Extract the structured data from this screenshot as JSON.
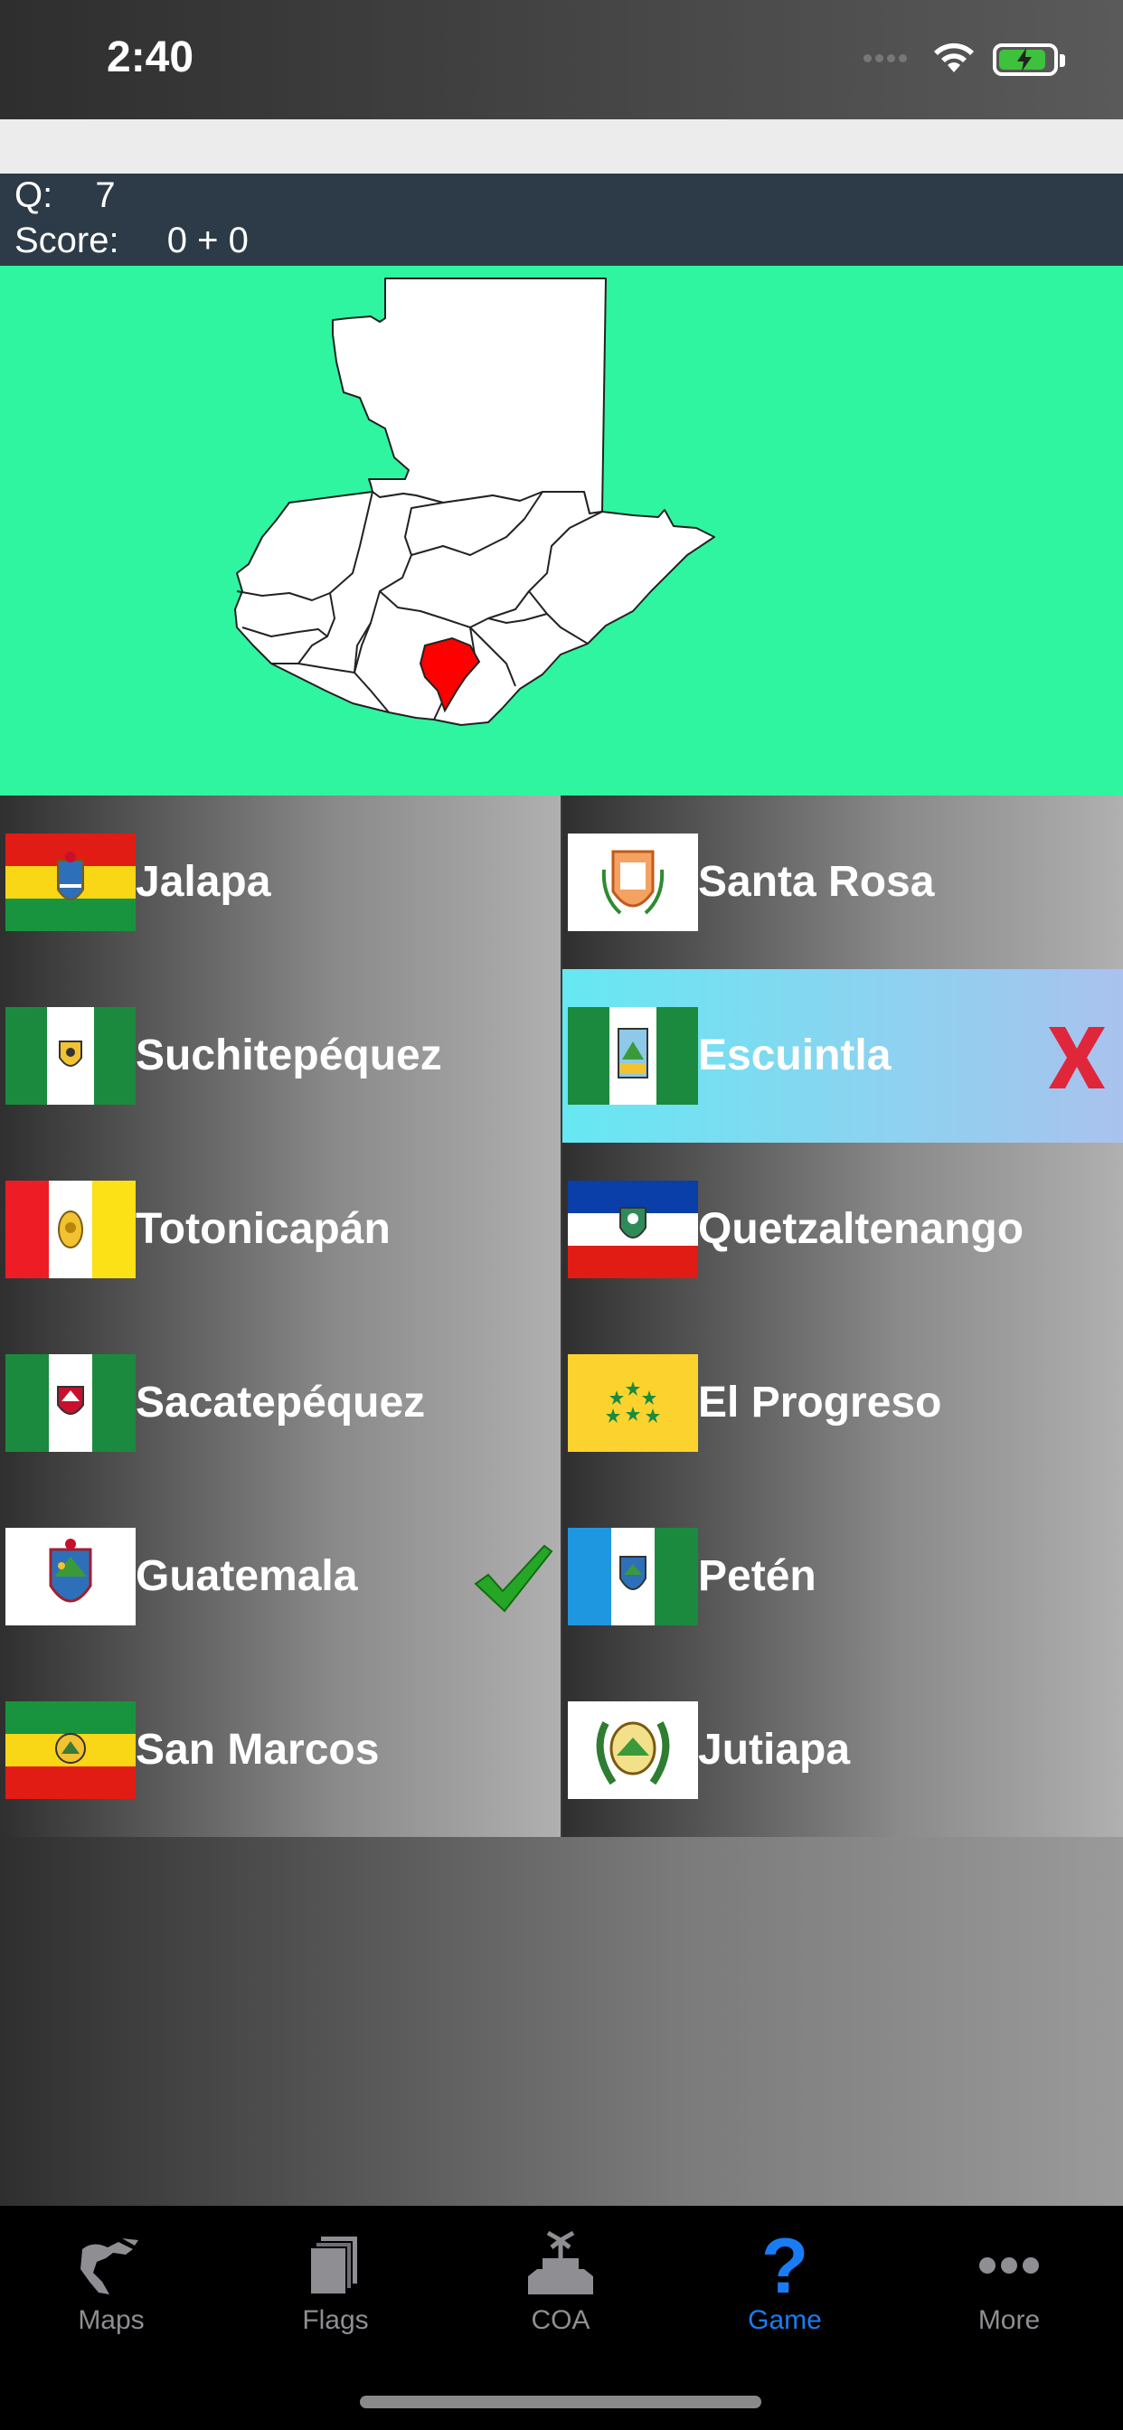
{
  "status_bar": {
    "time": "2:40"
  },
  "info": {
    "q_label": "Q:",
    "q_value": "7",
    "score_label": "Score:",
    "score_value": "0 + 0"
  },
  "answers": {
    "left": [
      {
        "name": "Jalapa",
        "flag": "red-yellow-green-tricolor-with-coat-of-arms"
      },
      {
        "name": "Suchitepéquez",
        "flag": "green-white-green-with-emblem"
      },
      {
        "name": "Totonicapán",
        "flag": "red-white-yellow-with-emblem"
      },
      {
        "name": "Sacatepéquez",
        "flag": "green-white-green-with-emblem"
      },
      {
        "name": "Guatemala",
        "flag": "white-with-coat-of-arms",
        "mark": "check-icon"
      },
      {
        "name": "San Marcos",
        "flag": "green-yellow-red-tricolor-with-emblem"
      }
    ],
    "right": [
      {
        "name": "Santa Rosa",
        "flag": "white-with-coat-of-arms"
      },
      {
        "name": "Escuintla",
        "flag": "green-white-green-with-emblem",
        "mark": "x-icon",
        "highlighted": true
      },
      {
        "name": "Quetzaltenango",
        "flag": "blue-white-red-with-emblem"
      },
      {
        "name": "El Progreso",
        "flag": "yellow-with-green-stars"
      },
      {
        "name": "Petén",
        "flag": "blue-white-green-with-emblem"
      },
      {
        "name": "Jutiapa",
        "flag": "white-with-wreath-emblem"
      }
    ]
  },
  "colors": {
    "map_bg": "#2ff5a1",
    "highlight_region": "#ff0000",
    "tab_active": "#1a7cf5",
    "tab_inactive": "#8e8e93"
  },
  "tabs": [
    {
      "label": "Maps",
      "icon": "map-icon"
    },
    {
      "label": "Flags",
      "icon": "flags-icon"
    },
    {
      "label": "COA",
      "icon": "coat-of-arms-icon"
    },
    {
      "label": "Game",
      "icon": "question-icon",
      "active": true
    },
    {
      "label": "More",
      "icon": "more-icon"
    }
  ]
}
